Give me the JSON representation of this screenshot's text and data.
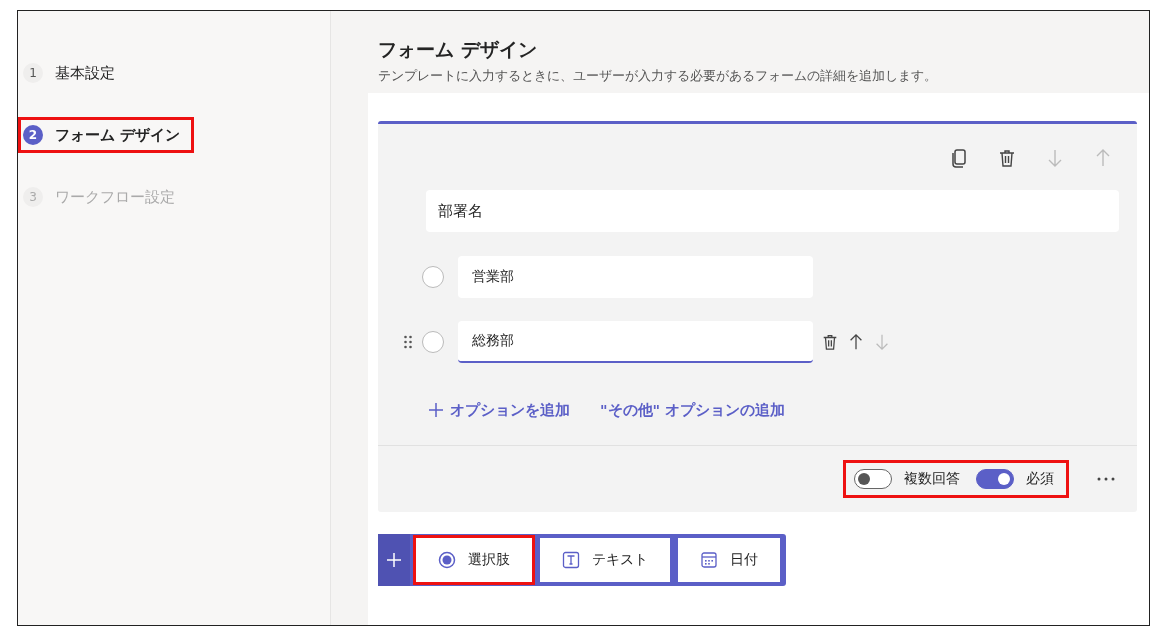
{
  "steps": [
    {
      "number": "1",
      "label": "基本設定",
      "selected": false,
      "disabled": false,
      "highlighted": false
    },
    {
      "number": "2",
      "label": "フォーム デザイン",
      "selected": true,
      "disabled": false,
      "highlighted": true
    },
    {
      "number": "3",
      "label": "ワークフロー設定",
      "selected": false,
      "disabled": true,
      "highlighted": false
    }
  ],
  "header": {
    "title": "フォーム デザイン",
    "subtitle": "テンプレートに入力するときに、ユーザーが入力する必要があるフォームの詳細を追加します。"
  },
  "question": {
    "title": "部署名",
    "options": [
      {
        "value": "営業部",
        "focused": false
      },
      {
        "value": "総務部",
        "focused": true
      }
    ],
    "add_option": "オプションを追加",
    "add_other": "\"その他\" オプションの追加",
    "toggles": [
      {
        "label": "複数回答",
        "on": false
      },
      {
        "label": "必須",
        "on": true
      }
    ],
    "toggles_highlighted": true
  },
  "add_bar": {
    "buttons": [
      {
        "kind": "choice",
        "label": "選択肢",
        "highlighted": true
      },
      {
        "kind": "text",
        "label": "テキスト",
        "highlighted": false
      },
      {
        "kind": "date",
        "label": "日付",
        "highlighted": false
      }
    ]
  }
}
